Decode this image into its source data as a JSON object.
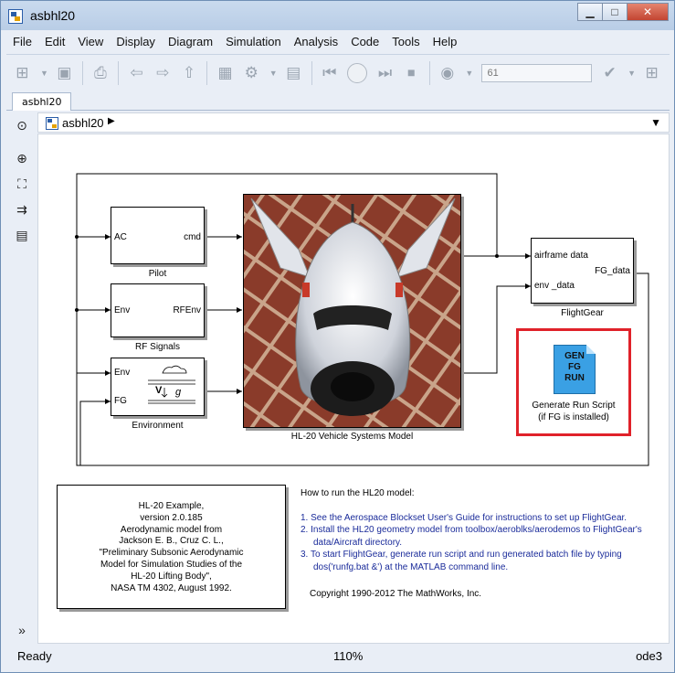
{
  "window": {
    "title": "asbhl20",
    "minimize": "▁",
    "maximize": "□",
    "close": "✕"
  },
  "menu": [
    "File",
    "Edit",
    "View",
    "Display",
    "Diagram",
    "Simulation",
    "Analysis",
    "Code",
    "Tools",
    "Help"
  ],
  "toolbar": {
    "stop_time": "61"
  },
  "tab": {
    "label": "asbhl20"
  },
  "address": {
    "model": "asbhl20"
  },
  "diagram": {
    "pilot": {
      "in": "AC",
      "out": "cmd",
      "caption": "Pilot"
    },
    "rf": {
      "in": "Env",
      "out": "RFEnv",
      "caption": "RF Signals"
    },
    "environment": {
      "in1": "Env",
      "in2": "FG",
      "caption": "Environment"
    },
    "vehicle": {
      "caption": "HL-20 Vehicle Systems Model"
    },
    "flightgear": {
      "in1": "airframe data",
      "in2": "env _data",
      "out": "FG_data",
      "caption": "FlightGear"
    },
    "runscript": {
      "icon_lines": [
        "GEN",
        "FG",
        "RUN"
      ],
      "caption_line1": "Generate Run Script",
      "caption_line2": "(if FG is installed)"
    }
  },
  "reference": {
    "lines": [
      "HL-20 Example,",
      "version 2.0.185",
      "Aerodynamic model from",
      "Jackson E. B., Cruz C. L.,",
      "\"Preliminary Subsonic Aerodynamic",
      "Model for Simulation Studies of the",
      "HL-20 Lifting Body\",",
      "NASA TM 4302, August 1992."
    ]
  },
  "info": {
    "heading": "How to run the HL20 model:",
    "steps": [
      "1. See the Aerospace Blockset User's Guide for instructions to set up FlightGear.",
      "2. Install the HL20 geometry model from toolbox/aeroblks/aerodemos to FlightGear's data/Aircraft directory.",
      "3. To start FlightGear, generate run script and run generated batch file by typing dos('runfg.bat &') at the MATLAB command line."
    ],
    "copyright": "Copyright 1990-2012 The MathWorks, Inc."
  },
  "status": {
    "left": "Ready",
    "zoom": "110%",
    "solver": "ode3"
  },
  "colors": {
    "highlight": "#e0222a",
    "icon_blue": "#3aa0e4",
    "link_text": "#1a2b9a"
  }
}
